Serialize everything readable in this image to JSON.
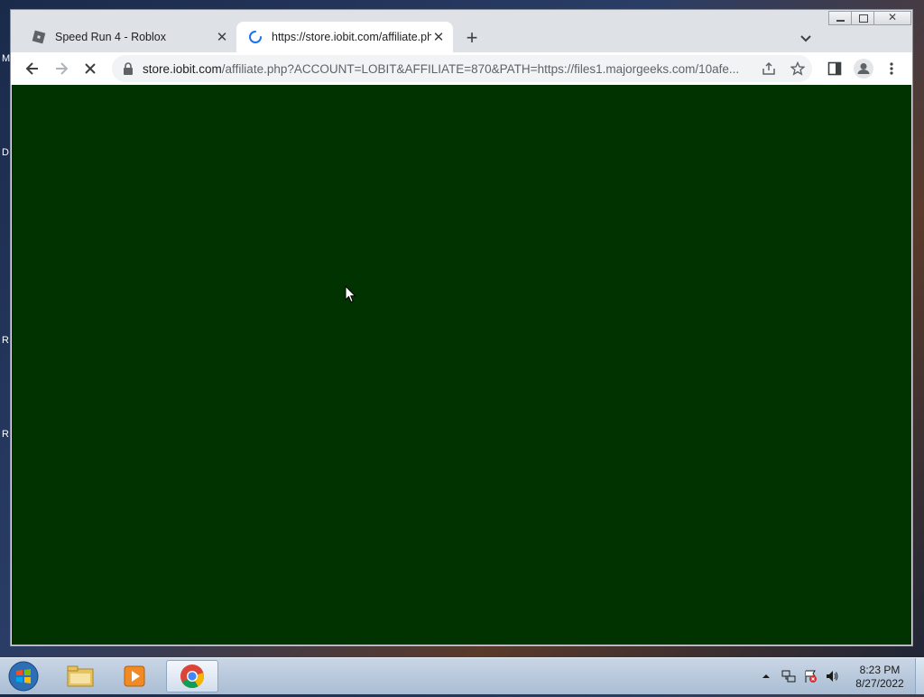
{
  "desktop": {
    "edge_letters": [
      {
        "text": "M"
      },
      {
        "text": "D"
      },
      {
        "text": "R"
      },
      {
        "text": "R"
      }
    ]
  },
  "browser": {
    "tabs": [
      {
        "title": "Speed Run 4 - Roblox",
        "state": "inactive",
        "favicon": "roblox-icon"
      },
      {
        "title": "https://store.iobit.com/affiliate.ph",
        "state": "active-loading",
        "favicon": "loading-spinner-icon"
      }
    ],
    "toolbar": {
      "url_host": "store.iobit.com",
      "url_rest": "/affiliate.php?ACCOUNT=LOBIT&AFFILIATE=870&PATH=https://files1.majorgeeks.com/10afe..."
    },
    "content_color": "#003300"
  },
  "taskbar": {
    "apps": [
      "file-explorer-icon",
      "media-player-icon",
      "chrome-icon"
    ],
    "clock": {
      "time": "8:23 PM",
      "date": "8/27/2022"
    }
  },
  "colors": {
    "tabbar": "#dee1e6",
    "page_background": "#003300",
    "taskbar": "#aabdd3"
  }
}
